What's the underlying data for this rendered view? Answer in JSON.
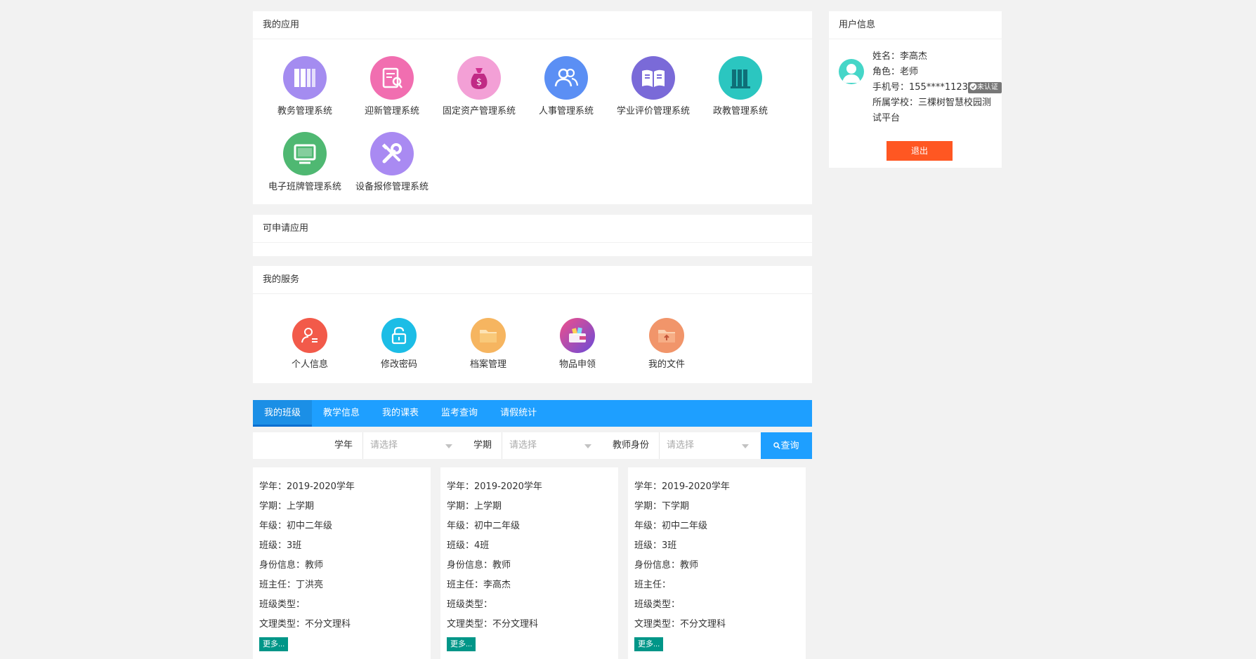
{
  "apps_panel": {
    "title": "我的应用",
    "items": [
      {
        "label": "教务管理系统",
        "icon": "books-icon",
        "color": "#a48cf0"
      },
      {
        "label": "迎新管理系统",
        "icon": "document-user-icon",
        "color": "#f16eb0"
      },
      {
        "label": "固定资产管理系统",
        "icon": "money-bag-icon",
        "color": "#f3a0d6"
      },
      {
        "label": "人事管理系统",
        "icon": "people-icon",
        "color": "#5b8ff4"
      },
      {
        "label": "学业评价管理系统",
        "icon": "open-book-icon",
        "color": "#7a6ad8"
      },
      {
        "label": "政教管理系统",
        "icon": "binders-icon",
        "color": "#2bc6c0"
      },
      {
        "label": "电子班牌管理系统",
        "icon": "monitor-icon",
        "color": "#4fb872"
      },
      {
        "label": "设备报修管理系统",
        "icon": "tools-icon",
        "color": "#a98af2"
      }
    ]
  },
  "apply_panel": {
    "title": "可申请应用"
  },
  "services_panel": {
    "title": "我的服务",
    "items": [
      {
        "label": "个人信息",
        "icon": "user-profile-icon",
        "color": "#f25a4a"
      },
      {
        "label": "修改密码",
        "icon": "lock-icon",
        "color": "#1cbde6"
      },
      {
        "label": "档案管理",
        "icon": "folder-icon",
        "color": "#f6b560"
      },
      {
        "label": "物品申领",
        "icon": "wallet-icon",
        "color": "#d84a8a"
      },
      {
        "label": "我的文件",
        "icon": "folder-upload-icon",
        "color": "#f1956a"
      }
    ]
  },
  "tabs": [
    "我的班级",
    "教学信息",
    "我的课表",
    "监考查询",
    "请假统计"
  ],
  "filters": {
    "year_label": "学年",
    "year_placeholder": "请选择",
    "term_label": "学期",
    "term_placeholder": "请选择",
    "role_label": "教师身份",
    "role_placeholder": "请选择",
    "query_label": "查询"
  },
  "cards": [
    {
      "year": "学年：2019-2020学年",
      "term": "学期：上学期",
      "grade": "年级：初中二年级",
      "class": "班级：3班",
      "identity": "身份信息：教师",
      "head_teacher": "班主任：丁洪亮",
      "class_type": "班级类型：",
      "subject_type": "文理类型：不分文理科",
      "more": "更多..."
    },
    {
      "year": "学年：2019-2020学年",
      "term": "学期：上学期",
      "grade": "年级：初中二年级",
      "class": "班级：4班",
      "identity": "身份信息：教师",
      "head_teacher": "班主任：李高杰",
      "class_type": "班级类型：",
      "subject_type": "文理类型：不分文理科",
      "more": "更多..."
    },
    {
      "year": "学年：2019-2020学年",
      "term": "学期：下学期",
      "grade": "年级：初中二年级",
      "class": "班级：3班",
      "identity": "身份信息：教师",
      "head_teacher": "班主任：",
      "class_type": "班级类型：",
      "subject_type": "文理类型：不分文理科",
      "more": "更多..."
    }
  ],
  "user_panel": {
    "title": "用户信息",
    "name": "姓名：李高杰",
    "role": "角色：老师",
    "phone": "手机号：155****1123",
    "verify_badge": "未认证",
    "school": "所属学校：三棵树智慧校园测试平台",
    "logout_label": "退出"
  }
}
